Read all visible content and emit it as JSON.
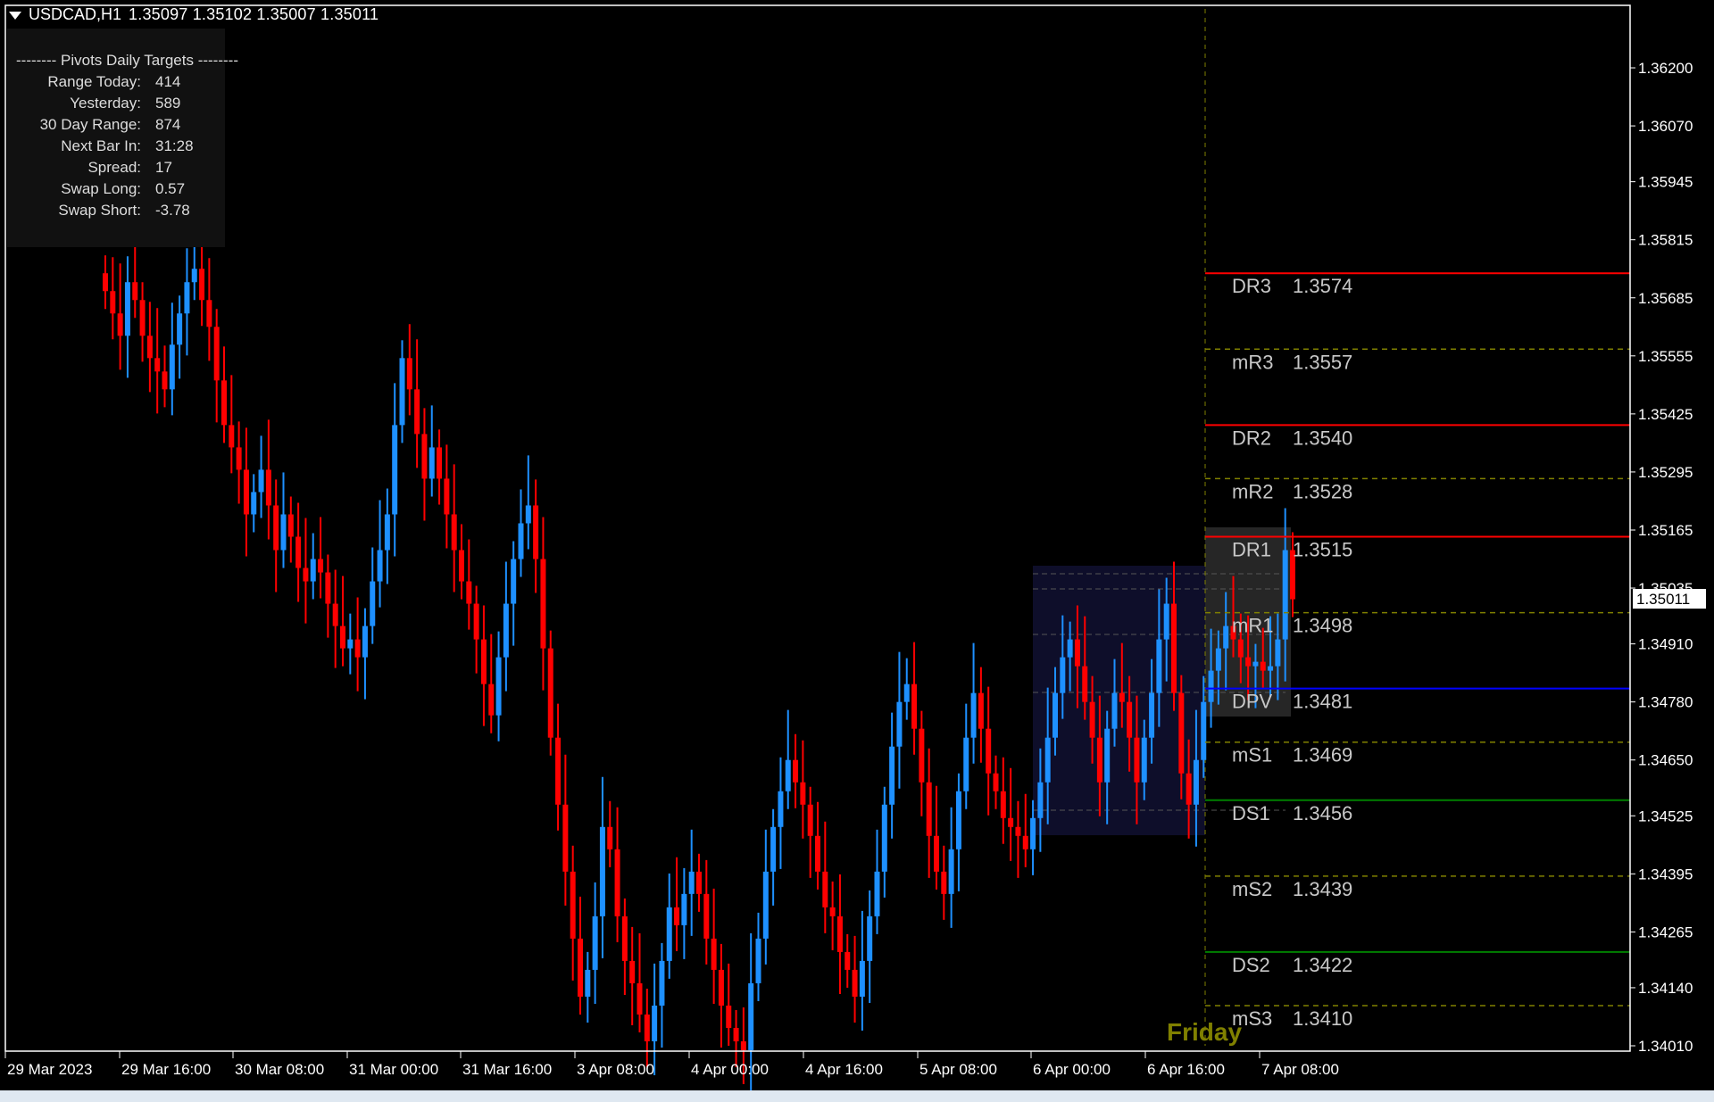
{
  "window": {
    "symbol": "USDCAD,H1",
    "ohlc": "1.35097 1.35102 1.35007 1.35011"
  },
  "pivot_panel": {
    "title": "-------- Pivots Daily Targets --------",
    "rows": [
      {
        "label": "Range  Today:",
        "value": "414"
      },
      {
        "label": "Yesterday:",
        "value": "589"
      },
      {
        "label": "30 Day Range:",
        "value": "874"
      },
      {
        "label": "Next Bar In:",
        "value": "31:28"
      },
      {
        "label": "Spread:",
        "value": "17"
      },
      {
        "label": "Swap  Long:",
        "value": "0.57"
      },
      {
        "label": "Swap  Short:",
        "value": "-3.78"
      }
    ]
  },
  "chart_data": {
    "type": "candlestick",
    "ylim": [
      1.3401,
      1.3626
    ],
    "y_ticks": [
      "1.36200",
      "1.36070",
      "1.35945",
      "1.35815",
      "1.35685",
      "1.35555",
      "1.35425",
      "1.35295",
      "1.35165",
      "1.35035",
      "1.34910",
      "1.34780",
      "1.34650",
      "1.34525",
      "1.34395",
      "1.34265",
      "1.34140",
      "1.34010"
    ],
    "current_price": "1.35011",
    "x_ticks": [
      "29 Mar 2023",
      "29 Mar 16:00",
      "30 Mar 08:00",
      "31 Mar 00:00",
      "31 Mar 16:00",
      "3 Apr 08:00",
      "4 Apr 00:00",
      "4 Apr 16:00",
      "5 Apr 08:00",
      "6 Apr 00:00",
      "6 Apr 16:00",
      "7 Apr 08:00"
    ],
    "colors": {
      "bull": "#1e90ff",
      "bear": "#ff0000",
      "background": "#000000",
      "axis_text": "#ffffff"
    },
    "approx_close_path": [
      1.357,
      1.3565,
      1.356,
      1.3572,
      1.3568,
      1.356,
      1.3555,
      1.3552,
      1.3548,
      1.3558,
      1.3565,
      1.3572,
      1.3575,
      1.3568,
      1.3562,
      1.355,
      1.354,
      1.3535,
      1.353,
      1.352,
      1.3525,
      1.353,
      1.3522,
      1.3512,
      1.352,
      1.3515,
      1.3508,
      1.3505,
      1.351,
      1.3507,
      1.35,
      1.3495,
      1.349,
      1.3492,
      1.3488,
      1.3495,
      1.3505,
      1.3512,
      1.352,
      1.354,
      1.3555,
      1.3548,
      1.3538,
      1.3528,
      1.3535,
      1.3528,
      1.352,
      1.3512,
      1.3505,
      1.35,
      1.3492,
      1.3482,
      1.3475,
      1.3488,
      1.35,
      1.351,
      1.3518,
      1.3522,
      1.351,
      1.349,
      1.347,
      1.3455,
      1.344,
      1.3425,
      1.3412,
      1.3418,
      1.343,
      1.345,
      1.3445,
      1.343,
      1.342,
      1.3415,
      1.3408,
      1.3402,
      1.341,
      1.342,
      1.3432,
      1.3428,
      1.3435,
      1.344,
      1.3435,
      1.3425,
      1.3418,
      1.341,
      1.3405,
      1.3402,
      1.34,
      1.3415,
      1.3425,
      1.344,
      1.345,
      1.3458,
      1.3465,
      1.346,
      1.3455,
      1.3448,
      1.344,
      1.3432,
      1.343,
      1.3422,
      1.3418,
      1.3412,
      1.342,
      1.343,
      1.344,
      1.3455,
      1.3468,
      1.3478,
      1.3482,
      1.3472,
      1.346,
      1.3448,
      1.344,
      1.3435,
      1.3445,
      1.3458,
      1.347,
      1.348,
      1.3472,
      1.3462,
      1.3458,
      1.3452,
      1.345,
      1.3448,
      1.3445,
      1.3452,
      1.346,
      1.347,
      1.348,
      1.3488,
      1.3492,
      1.3486,
      1.3478,
      1.347,
      1.346,
      1.3472,
      1.348,
      1.3478,
      1.347,
      1.346,
      1.347,
      1.348,
      1.3492,
      1.35,
      1.348,
      1.3462,
      1.3455,
      1.3465,
      1.3478,
      1.3485,
      1.349,
      1.3495,
      1.3492,
      1.3488,
      1.3486,
      1.3487,
      1.3485,
      1.3486,
      1.3492,
      1.3512,
      1.3501
    ]
  },
  "pivot_levels": [
    {
      "name": "DR3",
      "value": "1.3574",
      "color": "#ff0000",
      "style": "solid"
    },
    {
      "name": "mR3",
      "value": "1.3557",
      "color": "#808000",
      "style": "dashed"
    },
    {
      "name": "DR2",
      "value": "1.3540",
      "color": "#ff0000",
      "style": "solid"
    },
    {
      "name": "mR2",
      "value": "1.3528",
      "color": "#808000",
      "style": "dashed"
    },
    {
      "name": "DR1",
      "value": "1.3515",
      "color": "#ff0000",
      "style": "solid"
    },
    {
      "name": "mR1",
      "value": "1.3498",
      "color": "#808000",
      "style": "dashed"
    },
    {
      "name": "DPV",
      "value": "1.3481",
      "color": "#0000ff",
      "style": "solid"
    },
    {
      "name": "mS1",
      "value": "1.3469",
      "color": "#808000",
      "style": "dashed"
    },
    {
      "name": "DS1",
      "value": "1.3456",
      "color": "#008000",
      "style": "solid"
    },
    {
      "name": "mS2",
      "value": "1.3439",
      "color": "#808000",
      "style": "dashed"
    },
    {
      "name": "DS2",
      "value": "1.3422",
      "color": "#008000",
      "style": "solid"
    },
    {
      "name": "mS3",
      "value": "1.3410",
      "color": "#808000",
      "style": "dashed"
    }
  ],
  "day_label": "Friday"
}
